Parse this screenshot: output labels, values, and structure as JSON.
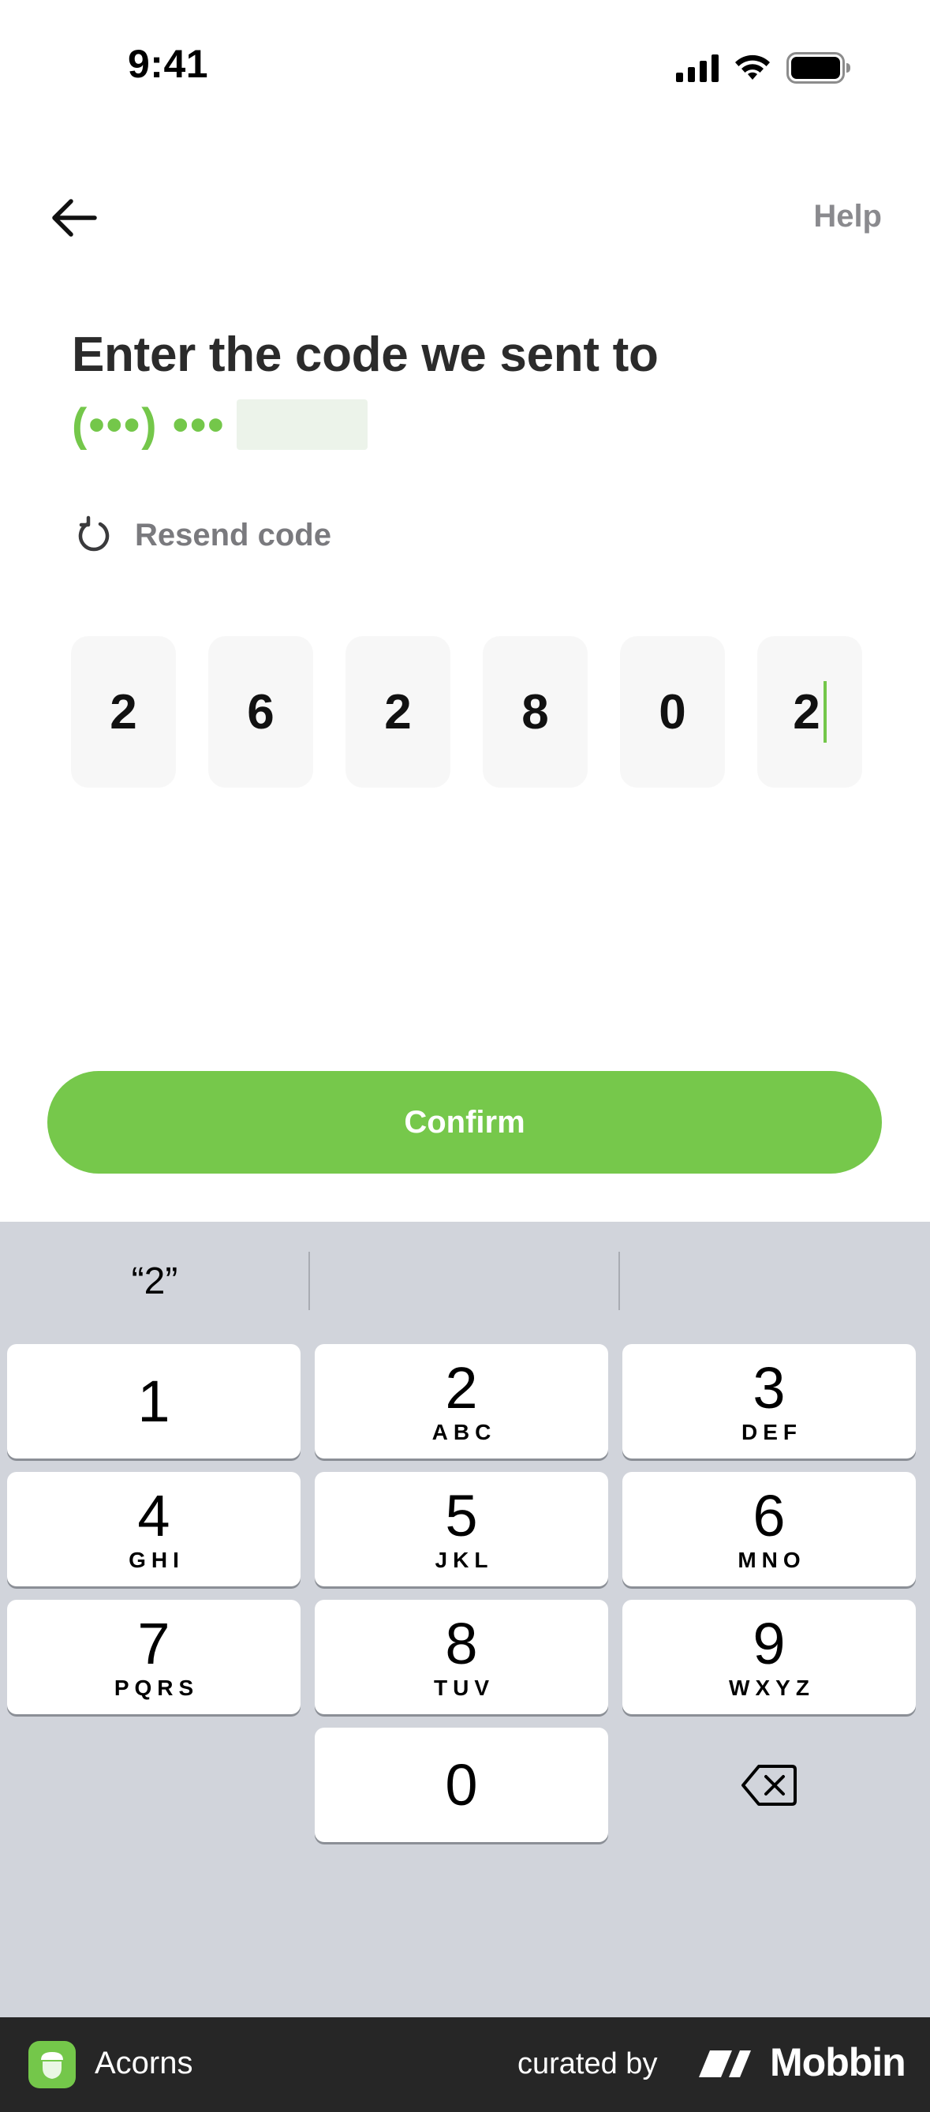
{
  "status_bar": {
    "time": "9:41"
  },
  "nav": {
    "help_label": "Help"
  },
  "heading": {
    "title": "Enter the code we sent to",
    "phone_masked": "(•••) •••"
  },
  "resend": {
    "label": "Resend code"
  },
  "code": {
    "digits": [
      "2",
      "6",
      "2",
      "8",
      "0",
      "2"
    ]
  },
  "confirm": {
    "label": "Confirm"
  },
  "keyboard": {
    "suggestion": "“2”",
    "keys": [
      {
        "num": "1",
        "letters": ""
      },
      {
        "num": "2",
        "letters": "ABC"
      },
      {
        "num": "3",
        "letters": "DEF"
      },
      {
        "num": "4",
        "letters": "GHI"
      },
      {
        "num": "5",
        "letters": "JKL"
      },
      {
        "num": "6",
        "letters": "MNO"
      },
      {
        "num": "7",
        "letters": "PQRS"
      },
      {
        "num": "8",
        "letters": "TUV"
      },
      {
        "num": "9",
        "letters": "WXYZ"
      },
      {
        "num": "0",
        "letters": ""
      }
    ],
    "delete_icon": "backspace-icon"
  },
  "footer": {
    "app_name": "Acorns",
    "curated_by": "curated by",
    "brand": "Mobbin"
  },
  "colors": {
    "accent": "#76c84b",
    "keyboard_bg": "#d1d4db",
    "footer_bg": "#262626"
  }
}
